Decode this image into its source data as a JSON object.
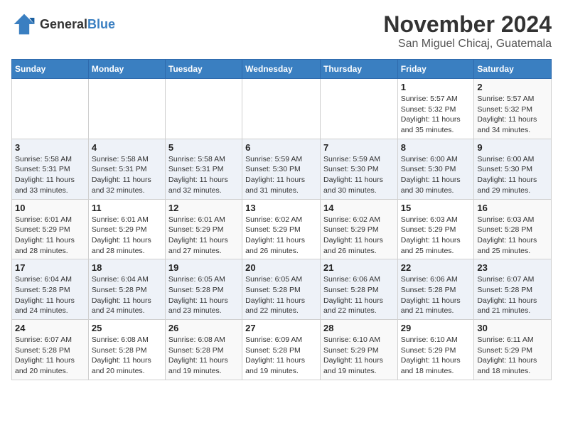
{
  "header": {
    "logo_general": "General",
    "logo_blue": "Blue",
    "month": "November 2024",
    "location": "San Miguel Chicaj, Guatemala"
  },
  "days_of_week": [
    "Sunday",
    "Monday",
    "Tuesday",
    "Wednesday",
    "Thursday",
    "Friday",
    "Saturday"
  ],
  "weeks": [
    [
      {
        "day": "",
        "info": ""
      },
      {
        "day": "",
        "info": ""
      },
      {
        "day": "",
        "info": ""
      },
      {
        "day": "",
        "info": ""
      },
      {
        "day": "",
        "info": ""
      },
      {
        "day": "1",
        "info": "Sunrise: 5:57 AM\nSunset: 5:32 PM\nDaylight: 11 hours and 35 minutes."
      },
      {
        "day": "2",
        "info": "Sunrise: 5:57 AM\nSunset: 5:32 PM\nDaylight: 11 hours and 34 minutes."
      }
    ],
    [
      {
        "day": "3",
        "info": "Sunrise: 5:58 AM\nSunset: 5:31 PM\nDaylight: 11 hours and 33 minutes."
      },
      {
        "day": "4",
        "info": "Sunrise: 5:58 AM\nSunset: 5:31 PM\nDaylight: 11 hours and 32 minutes."
      },
      {
        "day": "5",
        "info": "Sunrise: 5:58 AM\nSunset: 5:31 PM\nDaylight: 11 hours and 32 minutes."
      },
      {
        "day": "6",
        "info": "Sunrise: 5:59 AM\nSunset: 5:30 PM\nDaylight: 11 hours and 31 minutes."
      },
      {
        "day": "7",
        "info": "Sunrise: 5:59 AM\nSunset: 5:30 PM\nDaylight: 11 hours and 30 minutes."
      },
      {
        "day": "8",
        "info": "Sunrise: 6:00 AM\nSunset: 5:30 PM\nDaylight: 11 hours and 30 minutes."
      },
      {
        "day": "9",
        "info": "Sunrise: 6:00 AM\nSunset: 5:30 PM\nDaylight: 11 hours and 29 minutes."
      }
    ],
    [
      {
        "day": "10",
        "info": "Sunrise: 6:01 AM\nSunset: 5:29 PM\nDaylight: 11 hours and 28 minutes."
      },
      {
        "day": "11",
        "info": "Sunrise: 6:01 AM\nSunset: 5:29 PM\nDaylight: 11 hours and 28 minutes."
      },
      {
        "day": "12",
        "info": "Sunrise: 6:01 AM\nSunset: 5:29 PM\nDaylight: 11 hours and 27 minutes."
      },
      {
        "day": "13",
        "info": "Sunrise: 6:02 AM\nSunset: 5:29 PM\nDaylight: 11 hours and 26 minutes."
      },
      {
        "day": "14",
        "info": "Sunrise: 6:02 AM\nSunset: 5:29 PM\nDaylight: 11 hours and 26 minutes."
      },
      {
        "day": "15",
        "info": "Sunrise: 6:03 AM\nSunset: 5:29 PM\nDaylight: 11 hours and 25 minutes."
      },
      {
        "day": "16",
        "info": "Sunrise: 6:03 AM\nSunset: 5:28 PM\nDaylight: 11 hours and 25 minutes."
      }
    ],
    [
      {
        "day": "17",
        "info": "Sunrise: 6:04 AM\nSunset: 5:28 PM\nDaylight: 11 hours and 24 minutes."
      },
      {
        "day": "18",
        "info": "Sunrise: 6:04 AM\nSunset: 5:28 PM\nDaylight: 11 hours and 24 minutes."
      },
      {
        "day": "19",
        "info": "Sunrise: 6:05 AM\nSunset: 5:28 PM\nDaylight: 11 hours and 23 minutes."
      },
      {
        "day": "20",
        "info": "Sunrise: 6:05 AM\nSunset: 5:28 PM\nDaylight: 11 hours and 22 minutes."
      },
      {
        "day": "21",
        "info": "Sunrise: 6:06 AM\nSunset: 5:28 PM\nDaylight: 11 hours and 22 minutes."
      },
      {
        "day": "22",
        "info": "Sunrise: 6:06 AM\nSunset: 5:28 PM\nDaylight: 11 hours and 21 minutes."
      },
      {
        "day": "23",
        "info": "Sunrise: 6:07 AM\nSunset: 5:28 PM\nDaylight: 11 hours and 21 minutes."
      }
    ],
    [
      {
        "day": "24",
        "info": "Sunrise: 6:07 AM\nSunset: 5:28 PM\nDaylight: 11 hours and 20 minutes."
      },
      {
        "day": "25",
        "info": "Sunrise: 6:08 AM\nSunset: 5:28 PM\nDaylight: 11 hours and 20 minutes."
      },
      {
        "day": "26",
        "info": "Sunrise: 6:08 AM\nSunset: 5:28 PM\nDaylight: 11 hours and 19 minutes."
      },
      {
        "day": "27",
        "info": "Sunrise: 6:09 AM\nSunset: 5:28 PM\nDaylight: 11 hours and 19 minutes."
      },
      {
        "day": "28",
        "info": "Sunrise: 6:10 AM\nSunset: 5:29 PM\nDaylight: 11 hours and 19 minutes."
      },
      {
        "day": "29",
        "info": "Sunrise: 6:10 AM\nSunset: 5:29 PM\nDaylight: 11 hours and 18 minutes."
      },
      {
        "day": "30",
        "info": "Sunrise: 6:11 AM\nSunset: 5:29 PM\nDaylight: 11 hours and 18 minutes."
      }
    ]
  ]
}
